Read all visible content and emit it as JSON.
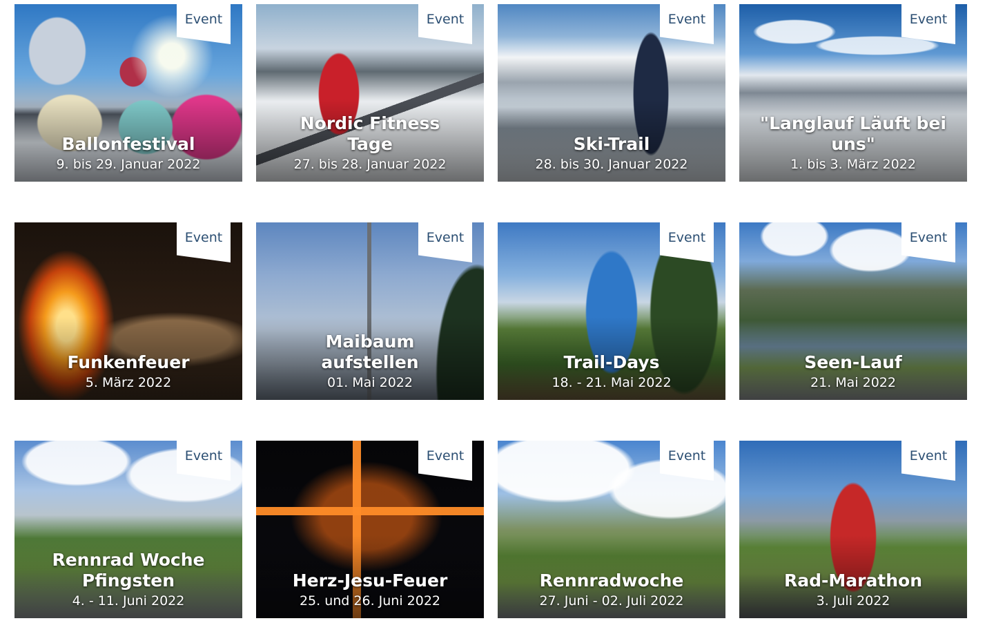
{
  "events": [
    {
      "title": "Ballonfestival",
      "date": "9. bis 29. Januar 2022",
      "badge": "Event"
    },
    {
      "title": "Nordic Fitness Tage",
      "date": "27. bis 28. Januar 2022",
      "badge": "Event"
    },
    {
      "title": "Ski-Trail",
      "date": "28. bis 30. Januar 2022",
      "badge": "Event"
    },
    {
      "title": "\"Langlauf Läuft bei uns\"",
      "date": "1. bis 3. März 2022",
      "badge": "Event"
    },
    {
      "title": "Funkenfeuer",
      "date": "5. März 2022",
      "badge": "Event"
    },
    {
      "title": "Maibaum aufstellen",
      "date": "01. Mai 2022",
      "badge": "Event"
    },
    {
      "title": "Trail-Days",
      "date": "18. - 21. Mai 2022",
      "badge": "Event"
    },
    {
      "title": "Seen-Lauf",
      "date": "21. Mai 2022",
      "badge": "Event"
    },
    {
      "title": "Rennrad Woche Pfingsten",
      "date": "4. - 11. Juni 2022",
      "badge": "Event"
    },
    {
      "title": "Herz-Jesu-Feuer",
      "date": "25. und 26. Juni 2022",
      "badge": "Event"
    },
    {
      "title": "Rennradwoche",
      "date": "27. Juni - 02. Juli 2022",
      "badge": "Event"
    },
    {
      "title": "Rad-Marathon",
      "date": "3. Juli 2022",
      "badge": "Event"
    }
  ],
  "colors": {
    "badge_text": "#2b4e72",
    "badge_bg": "#ffffff"
  }
}
